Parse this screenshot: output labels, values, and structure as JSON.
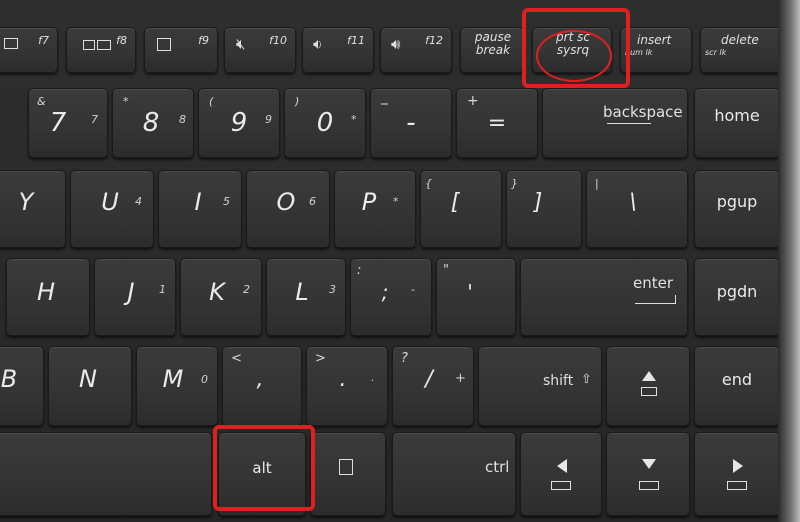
{
  "function_row": [
    {
      "fn": "f7"
    },
    {
      "fn": "f8"
    },
    {
      "fn": "f9"
    },
    {
      "fn": "f10"
    },
    {
      "fn": "f11"
    },
    {
      "fn": "f12"
    },
    {
      "top": "pause",
      "bottom": "break"
    },
    {
      "top": "prt sc",
      "bottom": "sysrq"
    },
    {
      "label": "insert",
      "sub": "num lk"
    },
    {
      "label": "delete",
      "sub": "scr lk"
    }
  ],
  "number_row": [
    {
      "shift": "&",
      "main": "7",
      "num": "7"
    },
    {
      "shift": "*",
      "main": "8",
      "num": "8"
    },
    {
      "shift": "(",
      "main": "9",
      "num": "9"
    },
    {
      "shift": ")",
      "main": "0",
      "num": "*"
    },
    {
      "shift": "_",
      "main": "-"
    },
    {
      "shift": "+",
      "main": "="
    },
    {
      "label": "backspace"
    },
    {
      "label": "home"
    }
  ],
  "top_row": [
    {
      "main": "Y"
    },
    {
      "main": "U",
      "num": "4"
    },
    {
      "main": "I",
      "num": "5"
    },
    {
      "main": "O",
      "num": "6"
    },
    {
      "main": "P",
      "num": "*"
    },
    {
      "shift": "{",
      "main": "["
    },
    {
      "shift": "}",
      "main": "]"
    },
    {
      "shift": "|",
      "main": "\\"
    },
    {
      "label": "pgup"
    }
  ],
  "home_row": [
    {
      "main": "H"
    },
    {
      "main": "J",
      "num": "1"
    },
    {
      "main": "K",
      "num": "2"
    },
    {
      "main": "L",
      "num": "3"
    },
    {
      "shift": ":",
      "main": ";",
      "num": "-"
    },
    {
      "shift": "\"",
      "main": "'"
    },
    {
      "label": "enter"
    },
    {
      "label": "pgdn"
    }
  ],
  "bottom_row": [
    {
      "main": "B"
    },
    {
      "main": "N"
    },
    {
      "main": "M",
      "num": "0"
    },
    {
      "shift": "<",
      "main": ","
    },
    {
      "shift": ">",
      "main": ".",
      "num": "."
    },
    {
      "shift": "?",
      "main": "/",
      "num": "+"
    },
    {
      "label": "shift"
    },
    {
      "label": "end"
    }
  ],
  "space_row": [
    {
      "label": "alt"
    },
    {
      "label": "ctrl"
    }
  ],
  "annotations": {
    "highlight_color": "#e02020"
  }
}
